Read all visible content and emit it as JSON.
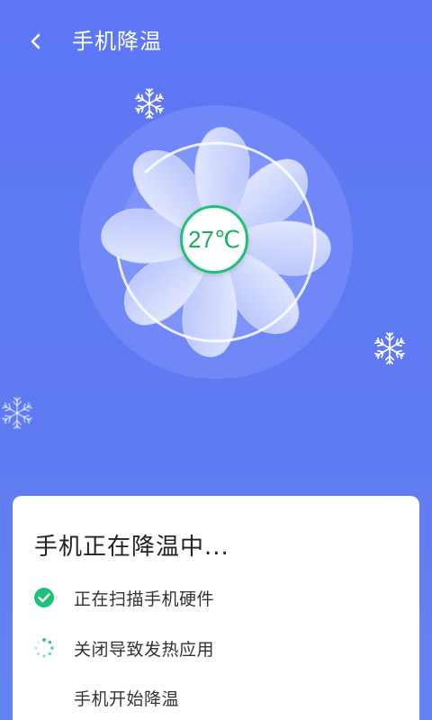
{
  "header": {
    "title": "手机降温",
    "back_icon": "chevron-left-icon"
  },
  "fan": {
    "temperature": "27℃",
    "progress": 0.85,
    "icon": "fan-icon"
  },
  "card": {
    "title": "手机正在降温中...",
    "steps": [
      {
        "label": "正在扫描手机硬件",
        "status": "done",
        "icon": "check-circle-icon"
      },
      {
        "label": "关闭导致发热应用",
        "status": "in-progress",
        "icon": "loading-spinner-icon"
      },
      {
        "label": "手机开始降温",
        "status": "pending",
        "icon": ""
      }
    ]
  },
  "colors": {
    "background": "#5d77f6",
    "accent_green": "#20c277",
    "card": "#ffffff"
  }
}
